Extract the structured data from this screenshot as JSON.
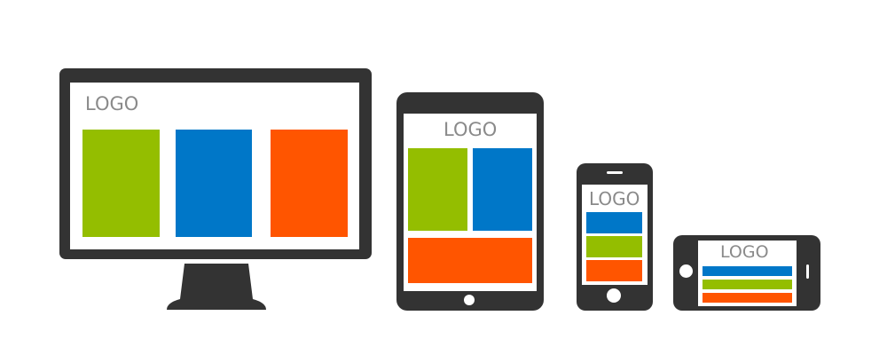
{
  "colors": {
    "device": "#333333",
    "screen": "#ffffff",
    "logo_text": "#8a8a8a",
    "green": "#94be00",
    "blue": "#0077c8",
    "orange": "#ff5500"
  },
  "devices": {
    "desktop": {
      "logo": "LOGO",
      "blocks": [
        "green",
        "blue",
        "orange"
      ]
    },
    "tablet": {
      "logo": "LOGO",
      "blocks": [
        "green",
        "blue",
        "orange"
      ]
    },
    "phone_portrait": {
      "logo": "LOGO",
      "blocks": [
        "blue",
        "green",
        "orange"
      ]
    },
    "phone_landscape": {
      "logo": "LOGO",
      "blocks": [
        "blue",
        "green",
        "orange"
      ]
    }
  },
  "icons": [
    "desktop-monitor-icon",
    "tablet-icon",
    "smartphone-icon",
    "smartphone-landscape-icon"
  ]
}
